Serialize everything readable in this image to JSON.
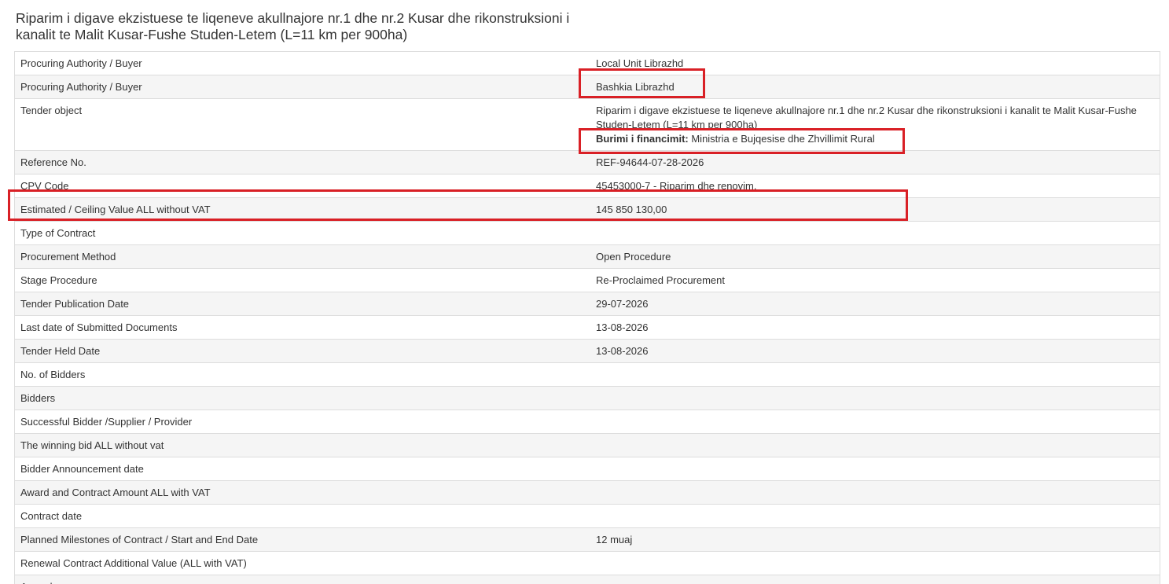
{
  "title_line1": "Riparim i digave ekzistuese te liqeneve akullnajore nr.1 dhe nr.2 Kusar dhe rikonstruksioni i",
  "title_line2": "kanalit te Malit Kusar-Fushe Studen-Letem (L=11 km per 900ha)",
  "rows": [
    {
      "label": "Procuring Authority / Buyer",
      "value": "Local Unit Librazhd"
    },
    {
      "label": "Procuring Authority / Buyer",
      "value": "Bashkia Librazhd"
    },
    {
      "label": "Tender object",
      "value": "Riparim i digave ekzistuese te liqeneve akullnajore nr.1 dhe nr.2 Kusar dhe rikonstruksioni i kanalit te Malit Kusar-Fushe Studen-Letem (L=11 km per 900ha)",
      "funding_label": "Burimi i financimit:",
      "funding_value": " Ministria e Bujqesise dhe Zhvillimit Rural"
    },
    {
      "label": "Reference No.",
      "value": "REF-94644-07-28-2026"
    },
    {
      "label": "CPV Code",
      "value": "45453000-7 - Riparim dhe renovim."
    },
    {
      "label": "Estimated / Ceiling Value ALL without VAT",
      "value": "145 850 130,00"
    },
    {
      "label": "Type of Contract",
      "value": ""
    },
    {
      "label": "Procurement Method",
      "value": "Open Procedure"
    },
    {
      "label": "Stage Procedure",
      "value": "Re-Proclaimed Procurement"
    },
    {
      "label": "Tender Publication Date",
      "value": "29-07-2026"
    },
    {
      "label": "Last date of Submitted Documents",
      "value": "13-08-2026"
    },
    {
      "label": "Tender Held Date",
      "value": "13-08-2026"
    },
    {
      "label": "No. of Bidders",
      "value": ""
    },
    {
      "label": "Bidders",
      "value": ""
    },
    {
      "label": "Successful Bidder /Supplier / Provider",
      "value": ""
    },
    {
      "label": "The winning bid ALL without vat",
      "value": ""
    },
    {
      "label": "Bidder Announcement date",
      "value": ""
    },
    {
      "label": "Award and Contract Amount ALL with VAT",
      "value": ""
    },
    {
      "label": "Contract date",
      "value": ""
    },
    {
      "label": "Planned Milestones of Contract / Start and End Date",
      "value": "12 muaj"
    },
    {
      "label": "Renewal Contract Additional Value (ALL with VAT)",
      "value": ""
    },
    {
      "label": "Appeals",
      "value": ""
    }
  ],
  "colors": {
    "highlight": "#d92026",
    "border": "#dddddd",
    "stripe": "#f5f5f5",
    "text": "#333333"
  }
}
